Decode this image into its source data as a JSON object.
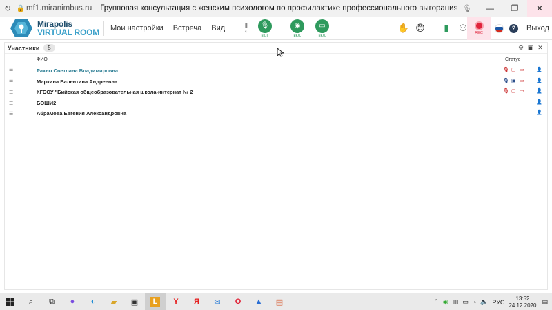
{
  "browser": {
    "domain": "mf1.miranimbus.ru",
    "page_title": "Групповая консультация с женским психологом по профилактике профессионального выгорания для педагог...",
    "window_controls": {
      "minimize": "—",
      "restore": "❐",
      "close": "✕"
    }
  },
  "app": {
    "logo_line1": "Mirapolis",
    "logo_line2": "VIRTUAL ROOM",
    "menu": [
      "Мои настройки",
      "Встреча",
      "Вид"
    ],
    "media": [
      {
        "icon": "microphone-icon",
        "label": "вкл."
      },
      {
        "icon": "webcam-icon",
        "label": "вкл."
      },
      {
        "icon": "screen-share-icon",
        "label": "вкл."
      }
    ],
    "rec_label": "REC",
    "exit_label": "Выход",
    "colors": {
      "accent_green": "#2e9a5d",
      "rec_red": "#e0233b",
      "self_name": "#2f7f95"
    }
  },
  "panel": {
    "title": "Участники",
    "count": "5",
    "col_fio": "ФИО",
    "col_status": "Статус",
    "participants": [
      {
        "name": "Рахно Светлана  Владимировна",
        "self": true,
        "mic": "muted",
        "cam": "off",
        "screen": "off",
        "role": "presenter"
      },
      {
        "name": "Маркина Валентина  Андреевна",
        "self": false,
        "mic": "on",
        "cam": "on",
        "screen": "off",
        "role": "presenter"
      },
      {
        "name": "КГБОУ \"Бийская общеобразовательная школа-интернат № 2",
        "self": false,
        "mic": "muted",
        "cam": "off",
        "screen": "off",
        "role": "presenter"
      },
      {
        "name": "БОШИ2",
        "self": false,
        "mic": "",
        "cam": "",
        "screen": "",
        "role": "listener"
      },
      {
        "name": "Абрамова  Евгения  Александровна",
        "self": false,
        "mic": "",
        "cam": "",
        "screen": "",
        "role": "listener"
      }
    ]
  },
  "taskbar": {
    "time": "13:52",
    "date": "24.12.2020",
    "language": "РУС"
  }
}
